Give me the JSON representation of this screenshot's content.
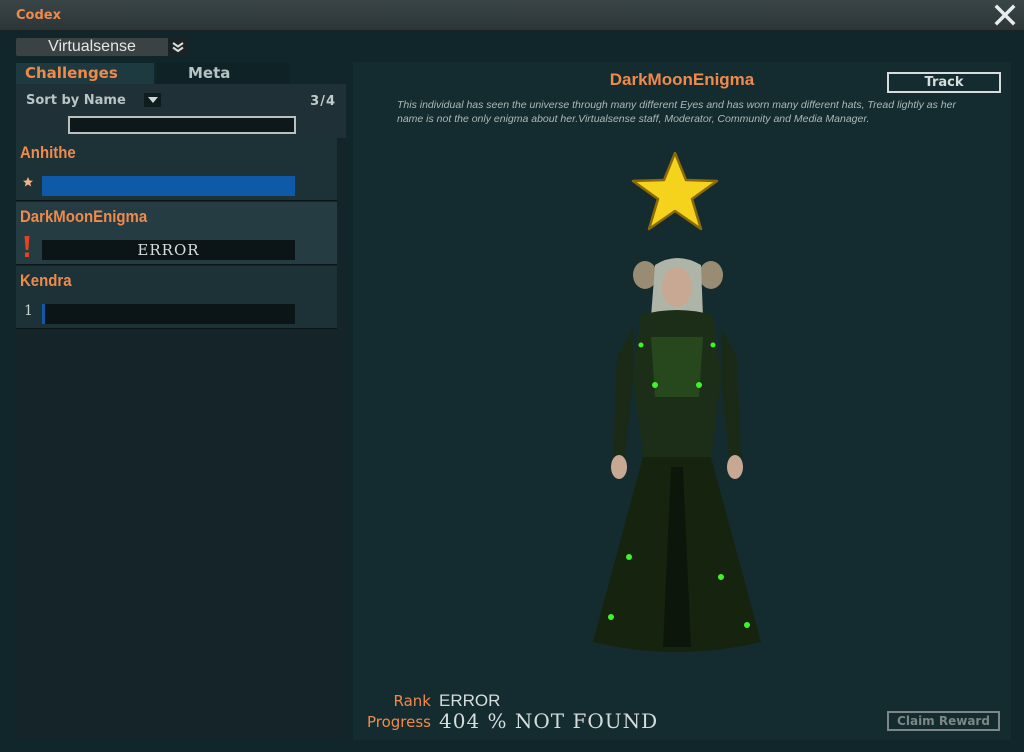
{
  "window": {
    "title": "Codex"
  },
  "account_select": {
    "value": "Virtualsense"
  },
  "tabs": [
    {
      "label": "Challenges"
    },
    {
      "label": "Meta"
    }
  ],
  "list_controls": {
    "sort_label": "Sort by Name",
    "count": "3/4",
    "search_value": ""
  },
  "challenges": [
    {
      "name": "Anhithe",
      "marker": "★",
      "progress": 1.0,
      "bar_text": ""
    },
    {
      "name": "DarkMoonEnigma",
      "marker": "!",
      "progress": 0,
      "bar_text": "ERROR"
    },
    {
      "name": "Kendra",
      "marker": "1",
      "progress": 0.01,
      "bar_text": ""
    }
  ],
  "detail": {
    "title": "DarkMoonEnigma",
    "track_label": "Track",
    "description": "This individual has seen the universe through many different Eyes and has worn many different hats, Tread lightly as her name is not the only enigma about her.Virtualsense staff, Moderator, Community and Media Manager.",
    "rank_label": "Rank",
    "rank_value": "ERROR",
    "progress_label": "Progress",
    "progress_value": "404 % NOT FOUND",
    "claim_label": "Claim Reward"
  },
  "colors": {
    "accent_orange": "#f08a4b",
    "bar_blue": "#0e59a8",
    "star_yellow": "#f5d21b",
    "error_red": "#e04426"
  },
  "icons": [
    "close-icon",
    "chevron-down-icon",
    "sort-dropdown-icon",
    "star-icon",
    "alert-icon",
    "rank-star-icon"
  ]
}
